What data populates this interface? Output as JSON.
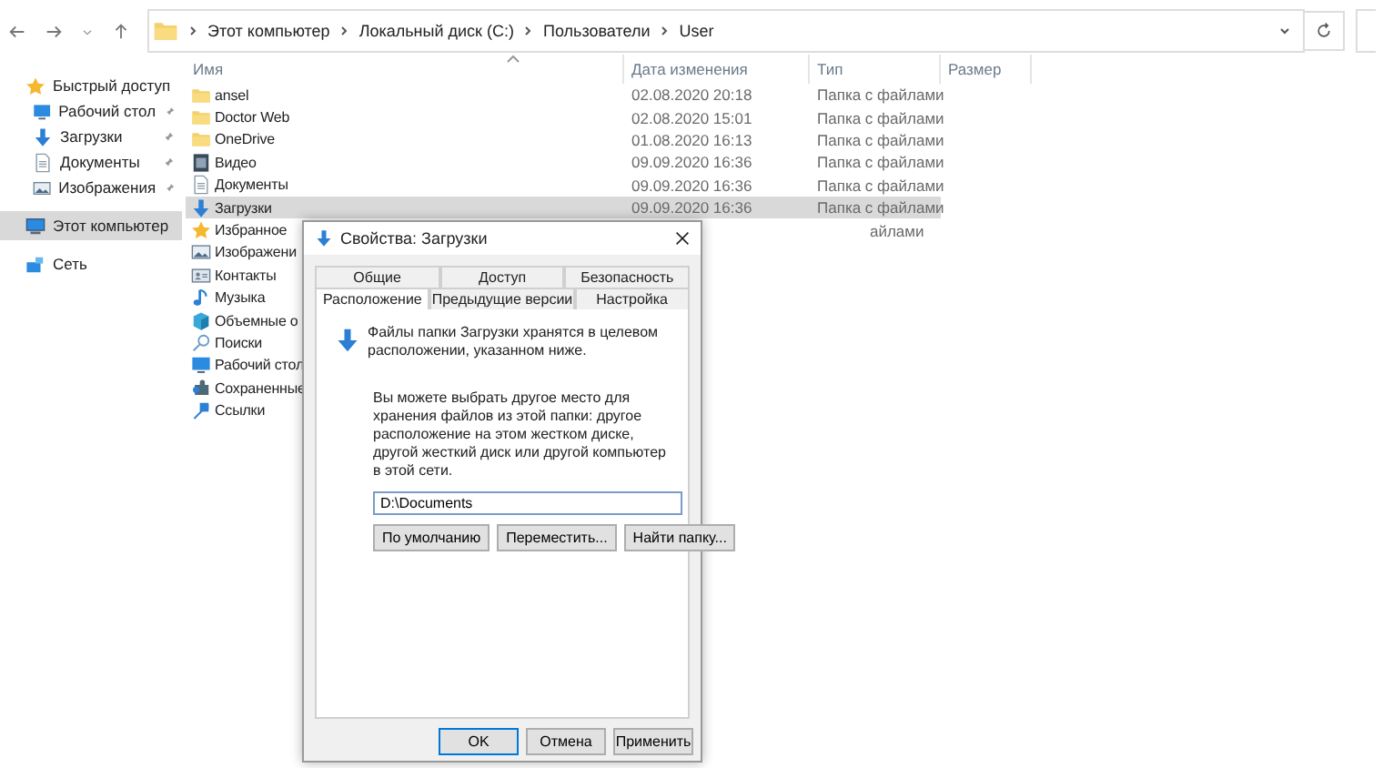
{
  "address_bar": {
    "path": [
      {
        "label": "Этот компьютер"
      },
      {
        "label": "Локальный диск (C:)"
      },
      {
        "label": "Пользователи"
      },
      {
        "label": "User"
      }
    ]
  },
  "sidebar": {
    "items": [
      {
        "label": "Быстрый доступ",
        "kind": "star",
        "pinned": false,
        "selected": false
      },
      {
        "label": "Рабочий стол",
        "kind": "desktop",
        "pinned": true,
        "selected": false
      },
      {
        "label": "Загрузки",
        "kind": "download",
        "pinned": true,
        "selected": false
      },
      {
        "label": "Документы",
        "kind": "document",
        "pinned": true,
        "selected": false
      },
      {
        "label": "Изображения",
        "kind": "pictures",
        "pinned": true,
        "selected": false
      },
      {
        "label": "Этот компьютер",
        "kind": "computer",
        "pinned": false,
        "selected": true
      },
      {
        "label": "Сеть",
        "kind": "network",
        "pinned": false,
        "selected": false
      }
    ]
  },
  "file_list": {
    "columns": [
      "Имя",
      "Дата изменения",
      "Тип",
      "Размер"
    ],
    "rows": [
      {
        "name": "ansel",
        "date": "02.08.2020 20:18",
        "type": "Папка с файлами",
        "kind": "folder",
        "selected": false
      },
      {
        "name": "Doctor Web",
        "date": "02.08.2020 15:01",
        "type": "Папка с файлами",
        "kind": "folder",
        "selected": false
      },
      {
        "name": "OneDrive",
        "date": "01.08.2020 16:13",
        "type": "Папка с файлами",
        "kind": "folder",
        "selected": false
      },
      {
        "name": "Видео",
        "date": "09.09.2020 16:36",
        "type": "Папка с файлами",
        "kind": "video",
        "selected": false
      },
      {
        "name": "Документы",
        "date": "09.09.2020 16:36",
        "type": "Папка с файлами",
        "kind": "document",
        "selected": false
      },
      {
        "name": "Загрузки",
        "date": "09.09.2020 16:36",
        "type": "Папка с файлами",
        "kind": "download",
        "selected": true
      },
      {
        "name": "Избранное",
        "type": "айлами",
        "kind": "star",
        "selected": false
      },
      {
        "name": "Изображени",
        "kind": "pictures",
        "selected": false
      },
      {
        "name": "Контакты",
        "kind": "contacts",
        "selected": false
      },
      {
        "name": "Музыка",
        "kind": "music",
        "selected": false
      },
      {
        "name": "Объемные о",
        "kind": "cube",
        "selected": false
      },
      {
        "name": "Поиски",
        "kind": "search",
        "selected": false
      },
      {
        "name": "Рабочий стол",
        "kind": "desktop",
        "selected": false
      },
      {
        "name": "Сохраненные",
        "kind": "saved",
        "selected": false
      },
      {
        "name": "Ссылки",
        "kind": "link",
        "selected": false
      }
    ]
  },
  "dialog": {
    "title": "Свойства: Загрузки",
    "tab_rows": [
      [
        {
          "label": "Общие",
          "selected": false
        },
        {
          "label": "Доступ",
          "selected": false
        },
        {
          "label": "Безопасность",
          "selected": false
        }
      ],
      [
        {
          "label": "Расположение",
          "selected": true
        },
        {
          "label": "Предыдущие версии",
          "selected": false
        },
        {
          "label": "Настройка",
          "selected": false
        }
      ]
    ],
    "info": "Файлы папки Загрузки хранятся в целевом расположении, указанном ниже.",
    "description": "Вы можете выбрать другое место для хранения файлов из этой папки: другое расположение на этом жестком диске, другой жесткий диск или другой компьютер в этой сети.",
    "path_field": {
      "value": "D:\\Documents"
    },
    "location_buttons": [
      "По умолчанию",
      "Переместить...",
      "Найти папку..."
    ],
    "buttons": [
      {
        "label": "OK",
        "default": true
      },
      {
        "label": "Отмена",
        "default": false
      },
      {
        "label": "Применить",
        "default": false
      }
    ]
  }
}
